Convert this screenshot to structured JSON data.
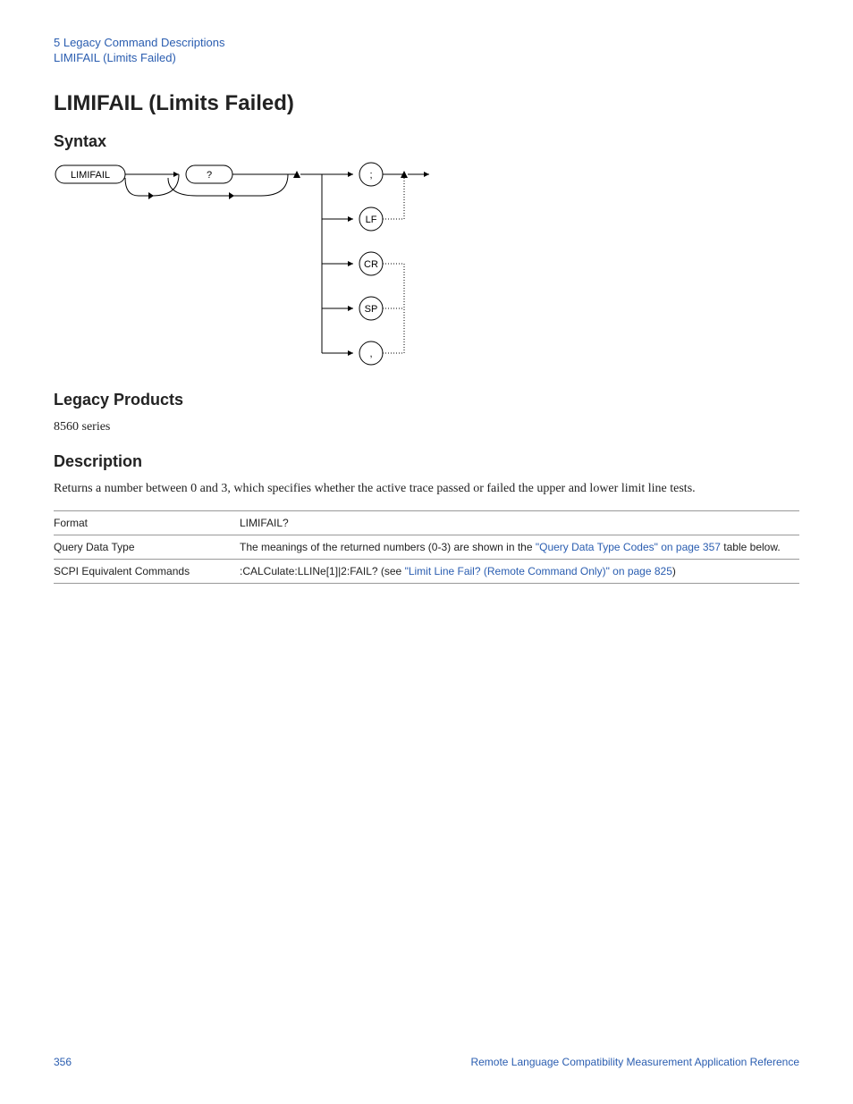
{
  "header": {
    "chapter": "5  Legacy Command Descriptions",
    "section": "LIMIFAIL (Limits Failed)"
  },
  "title": "LIMIFAIL (Limits Failed)",
  "sections": {
    "syntax": "Syntax",
    "legacy_products": "Legacy Products",
    "description": "Description"
  },
  "syntax_diagram": {
    "start_node": "LIMIFAIL",
    "question_node": "?",
    "terminators": [
      ";",
      "LF",
      "CR",
      "SP",
      ","
    ]
  },
  "legacy_products_text": "8560 series",
  "description_text": "Returns a number between 0 and 3, which specifies whether the active trace passed or failed the upper and lower limit line tests.",
  "table": {
    "rows": [
      {
        "label": "Format",
        "value": "LIMIFAIL?"
      },
      {
        "label": "Query Data Type",
        "prefix": "The meanings of the returned numbers (0-3) are shown in the ",
        "link": "\"Query Data Type Codes\" on page 357",
        "suffix": " table below."
      },
      {
        "label": "SCPI Equivalent Commands",
        "prefix": ":CALCulate:LLINe[1]|2:FAIL? (see ",
        "link": "\"Limit Line Fail? (Remote Command Only)\" on page 825",
        "suffix": ")"
      }
    ]
  },
  "footer": {
    "page": "356",
    "doc": "Remote Language Compatibility Measurement Application Reference"
  }
}
